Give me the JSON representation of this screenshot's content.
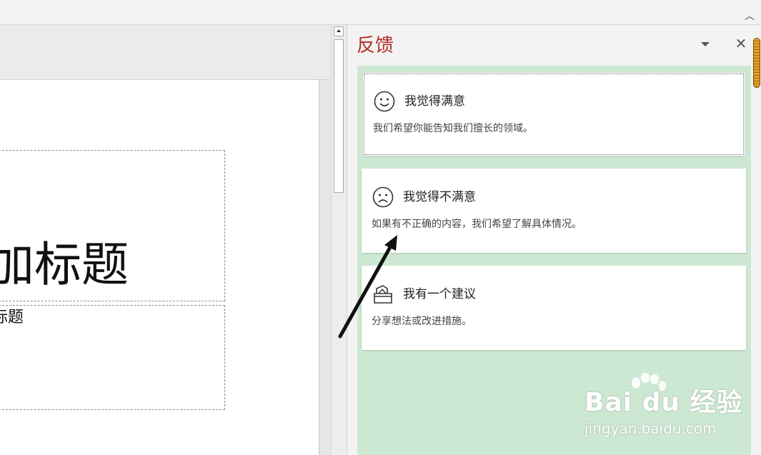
{
  "window": {
    "collapse_icon": "chevron-up-icon"
  },
  "slide": {
    "title_text": "加标题",
    "subtitle_text": "标题"
  },
  "feedback_pane": {
    "title": "反馈",
    "title_color": "#b02f24",
    "background_color": "#cce8d2",
    "dropdown_icon": "caret-down-icon",
    "close_icon": "close-icon",
    "close_label": "×",
    "options": [
      {
        "icon": "smile-icon",
        "title": "我觉得满意",
        "description": "我们希望你能告知我们擅长的领域。",
        "selected": true
      },
      {
        "icon": "frown-icon",
        "title": "我觉得不满意",
        "description": "如果有不正确的内容，我们希望了解具体情况。",
        "selected": false
      },
      {
        "icon": "suggestion-box-icon",
        "title": "我有一个建议",
        "description": "分享想法或改进措施。",
        "selected": false
      }
    ]
  },
  "watermark": {
    "brand": "Bai du 经验",
    "url": "jingyan.baidu.com"
  }
}
